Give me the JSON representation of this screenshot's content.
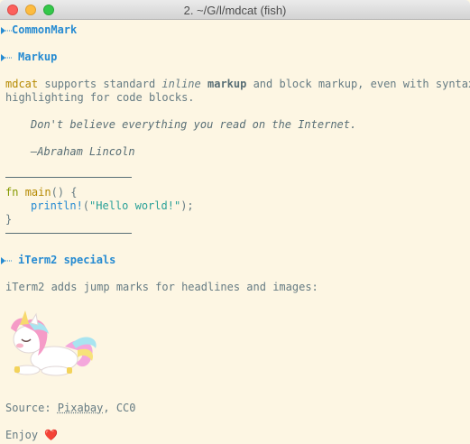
{
  "window": {
    "title": "2. ~/G/l/mdcat (fish)"
  },
  "headings": {
    "commonmark": "CommonMark",
    "markup": "Markup",
    "iterm": "iTerm2 specials"
  },
  "markup_para": {
    "cmd": "mdcat",
    "t1": " supports standard ",
    "em": "inline",
    "t2": " ",
    "strong": "markup",
    "t3": " and block markup, even with syntax",
    "line2": "highlighting for code blocks."
  },
  "quote": {
    "text": "Don't believe everything you read on the Internet.",
    "author": "—Abraham Lincoln"
  },
  "code": {
    "kw": "fn",
    "name": "main",
    "sig": "() {",
    "macro": "println!",
    "open": "(",
    "str": "\"Hello world!\"",
    "close": ");",
    "end": "}"
  },
  "iterm_para": "iTerm2 adds jump marks for headlines and images:",
  "source": {
    "prefix": "Source: ",
    "link": "Pixabay",
    "suffix": ", CC0"
  },
  "enjoy": {
    "text": "Enjoy ",
    "emoji": "❤️"
  },
  "colors": {
    "background": "#fdf6e3",
    "text": "#657b83",
    "heading": "#268bd2",
    "keyword": "#859900",
    "function": "#b58900",
    "string": "#2aa198"
  }
}
